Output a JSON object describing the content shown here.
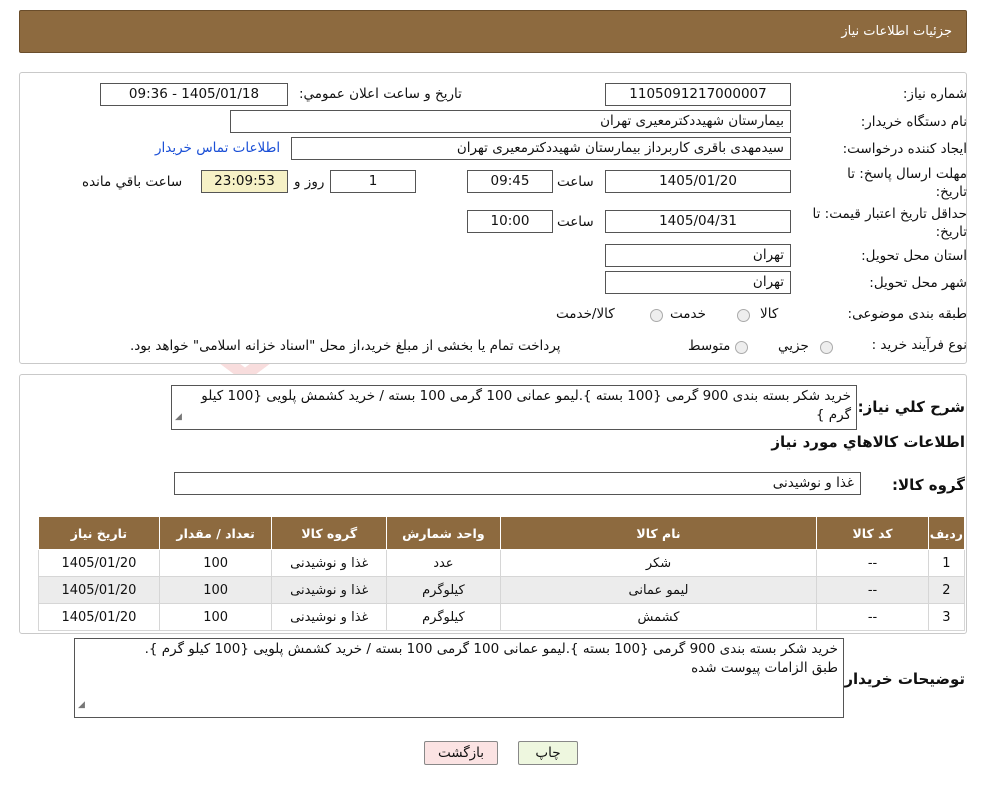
{
  "header": {
    "title": "جزئیات اطلاعات نیاز"
  },
  "form": {
    "need_number_label": "شماره نیاز:",
    "need_number": "1105091217000007",
    "announce_label": "تاریخ و ساعت اعلان عمومي:",
    "announce_value": "1405/01/18 - 09:36",
    "buyer_org_label": "نام دستگاه خریدار:",
    "buyer_org": "بیمارستان شهیددکترمعیری تهران",
    "creator_label": "ایجاد کننده درخواست:",
    "creator": "سیدمهدی باقری کاربرداز بیمارستان شهیددکترمعیری تهران",
    "contact_link": "اطلاعات تماس خریدار",
    "deadline_label": "مهلت ارسال پاسخ: تا تاریخ:",
    "deadline_date": "1405/01/20",
    "time_label": "ساعت",
    "deadline_time": "09:45",
    "days_value": "1",
    "days_label": "روز و",
    "remaining_time": "23:09:53",
    "remaining_label": "ساعت باقي مانده",
    "price_validity_label": "حداقل تاریخ اعتبار قیمت: تا تاریخ:",
    "price_validity_date": "1405/04/31",
    "price_validity_time": "10:00",
    "province_label": "استان محل تحویل:",
    "province": "تهران",
    "city_label": "شهر محل تحویل:",
    "city": "تهران",
    "category_label": "طبقه بندی موضوعی:",
    "category_options": [
      "کالا",
      "خدمت",
      "کالا/خدمت"
    ],
    "process_label": "نوع فرآیند خرید :",
    "process_options": [
      "جزیي",
      "متوسط"
    ],
    "process_note": "پرداخت تمام یا بخشی از مبلغ خرید،از محل \"اسناد خزانه اسلامی\" خواهد بود."
  },
  "summary": {
    "label": "شرح کلي نیاز:",
    "text": "خرید شکر بسته بندی 900 گرمی {100 بسته }.لیمو عمانی 100 گرمی 100 بسته / خرید کشمش پلویی {100 کیلو گرم }",
    "items_title": "اطلاعات کالاهاي مورد نیاز",
    "group_label": "گروه کالا:",
    "group_value": "غذا و نوشیدنی"
  },
  "table": {
    "headers": [
      "ردیف",
      "کد کالا",
      "نام کالا",
      "واحد شمارش",
      "گروه کالا",
      "تعداد / مقدار",
      "تاریخ نیاز"
    ],
    "rows": [
      [
        "1",
        "--",
        "شکر",
        "عدد",
        "غذا و نوشیدنی",
        "100",
        "1405/01/20"
      ],
      [
        "2",
        "--",
        "لیمو عمانی",
        "کیلوگرم",
        "غذا و نوشیدنی",
        "100",
        "1405/01/20"
      ],
      [
        "3",
        "--",
        "کشمش",
        "کیلوگرم",
        "غذا و نوشیدنی",
        "100",
        "1405/01/20"
      ]
    ]
  },
  "notes": {
    "label": "توضیحات خریدار:",
    "line1": "خرید شکر بسته بندی 900 گرمی {100 بسته }.لیمو عمانی 100 گرمی 100 بسته / خرید کشمش پلویی {100 کیلو گرم }.",
    "line2": "طبق الزامات پیوست شده"
  },
  "buttons": {
    "print": "چاپ",
    "back": "بازگشت"
  },
  "watermark": {
    "text": "AriaTender.neT"
  },
  "colors": {
    "header_bg": "#8d6a3f",
    "link": "#1a4fd6",
    "remaining_bg": "#f6f1c6",
    "print_bg": "#eef7df",
    "back_bg": "#fbe3e3"
  }
}
